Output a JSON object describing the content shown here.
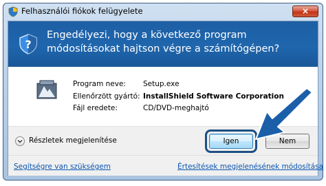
{
  "window": {
    "title": "Felhasználói fiókok felügyelete",
    "close_label": "×"
  },
  "banner": {
    "question": "Engedélyezi, hogy a következő program módosításokat hajtson végre a számítógépen?"
  },
  "details": {
    "program_name_label": "Program neve:",
    "program_name_value": "Setup.exe",
    "publisher_label": "Ellenőrzött gyártó:",
    "publisher_value": "InstallShield Software Corporation",
    "origin_label": "Fájl eredete:",
    "origin_value": "CD/DVD-meghajtó"
  },
  "footer": {
    "show_details_label": "Részletek megjelenítése",
    "yes_label": "Igen",
    "no_label": "Nem"
  },
  "links": {
    "help": "Segítségre van szükségem",
    "notification_settings": "Értesítések megjelenésének módosítása"
  },
  "colors": {
    "banner": "#1f66ad",
    "arrow": "#1b5fa8",
    "highlight": "#1c4f84"
  }
}
